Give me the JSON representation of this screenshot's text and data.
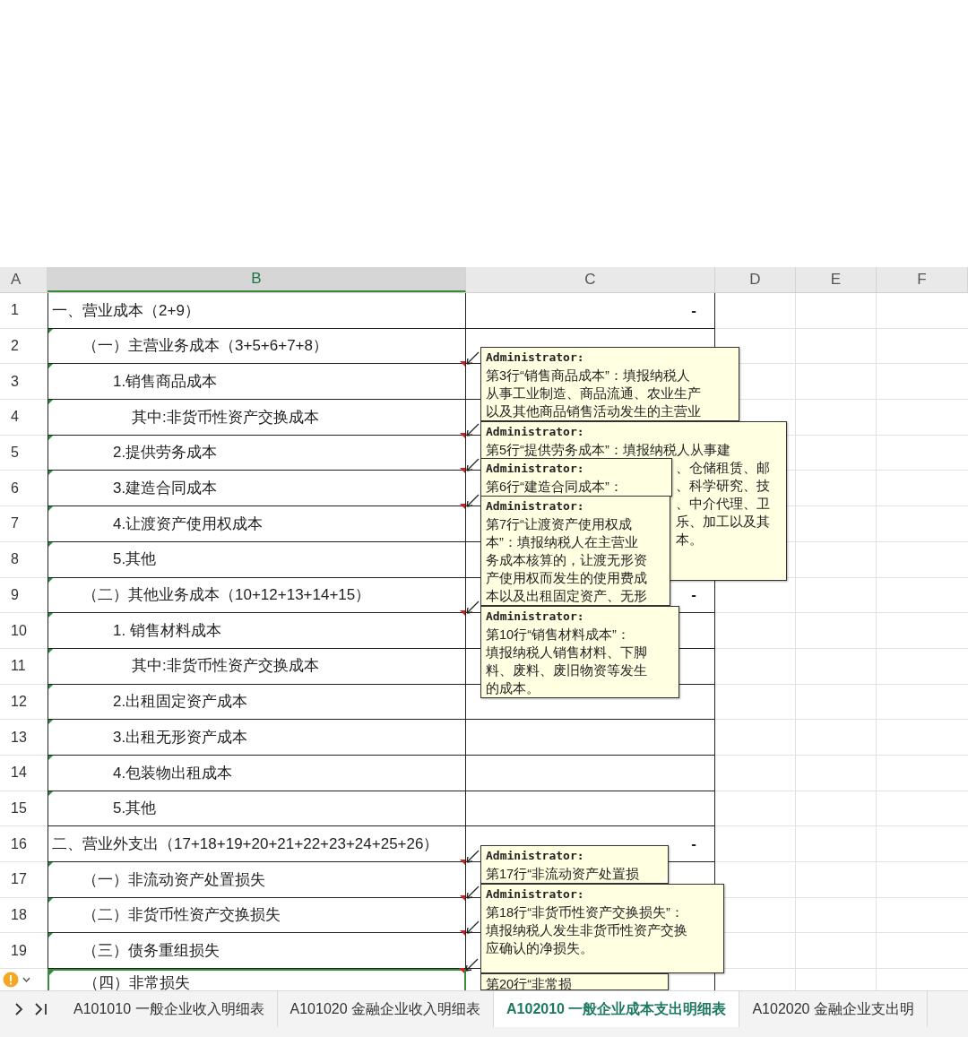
{
  "columns": [
    {
      "label": "A",
      "selected": false
    },
    {
      "label": "B",
      "selected": true
    },
    {
      "label": "C",
      "selected": false
    },
    {
      "label": "D",
      "selected": false
    },
    {
      "label": "E",
      "selected": false
    },
    {
      "label": "F",
      "selected": false
    }
  ],
  "rows": [
    {
      "number": "1",
      "kind": "section",
      "item": "一、营业成本（2+9）",
      "value": "-",
      "flagged": false,
      "has_comment": false
    },
    {
      "number": "2",
      "kind": "group",
      "item": "（一）主营业务成本（3+5+6+7+8）",
      "flagged": true,
      "has_comment": false
    },
    {
      "number": "3",
      "kind": "item",
      "item": "1.销售商品成本",
      "flagged": true,
      "has_comment": true,
      "comment": {
        "author": "Administrator:",
        "lines": [
          "第3行“销售商品成本”：填报纳税人",
          "从事工业制造、商品流通、农业生产",
          "以及其他商品销售活动发生的主营业"
        ]
      }
    },
    {
      "number": "4",
      "kind": "subitem",
      "item": "其中:非货币性资产交换成本",
      "flagged": true,
      "has_comment": false
    },
    {
      "number": "5",
      "kind": "item",
      "item": "2.提供劳务成本",
      "flagged": true,
      "has_comment": true,
      "comment": {
        "author": "Administrator:",
        "lines": [
          "第5行“提供劳务成本”：填报纳税人从事建"
        ],
        "covered_lines": [
          "、仓储租赁、邮",
          "、科学研究、技",
          "、中介代理、卫",
          "乐、加工以及其",
          "本。"
        ]
      }
    },
    {
      "number": "6",
      "kind": "item",
      "item": "3.建造合同成本",
      "flagged": true,
      "has_comment": true,
      "comment": {
        "author": "Administrator:",
        "lines": [
          "第6行“建造合同成本”："
        ]
      }
    },
    {
      "number": "7",
      "kind": "item",
      "item": "4.让渡资产使用权成本",
      "flagged": true,
      "has_comment": true,
      "comment": {
        "author": "Administrator:",
        "lines": [
          "第7行“让渡资产使用权成",
          "本”：填报纳税人在主营业",
          "务成本核算的，让渡无形资",
          "产使用权而发生的使用费成",
          "本以及出租固定资产、无形"
        ]
      }
    },
    {
      "number": "8",
      "kind": "item",
      "item": "5.其他",
      "flagged": true,
      "has_comment": false
    },
    {
      "number": "9",
      "kind": "group",
      "item": "（二）其他业务成本（10+12+13+14+15）",
      "value": "-",
      "flagged": true,
      "has_comment": false
    },
    {
      "number": "10",
      "kind": "item",
      "item": "1.  销售材料成本",
      "flagged": true,
      "has_comment": true,
      "comment": {
        "author": "Administrator:",
        "lines": [
          "第10行“销售材料成本”：",
          "填报纳税人销售材料、下脚",
          "料、废料、废旧物资等发生",
          "的成本。"
        ]
      }
    },
    {
      "number": "11",
      "kind": "subitem",
      "item": "其中:非货币性资产交换成本",
      "flagged": true,
      "has_comment": false
    },
    {
      "number": "12",
      "kind": "item",
      "item": "2.出租固定资产成本",
      "flagged": true,
      "has_comment": false
    },
    {
      "number": "13",
      "kind": "item",
      "item": "3.出租无形资产成本",
      "flagged": true,
      "has_comment": false
    },
    {
      "number": "14",
      "kind": "item",
      "item": "4.包装物出租成本",
      "flagged": true,
      "has_comment": false
    },
    {
      "number": "15",
      "kind": "item",
      "item": "5.其他",
      "flagged": true,
      "has_comment": false
    },
    {
      "number": "16",
      "kind": "section",
      "item": "二、营业外支出（17+18+19+20+21+22+23+24+25+26）",
      "value": "-",
      "flagged": false,
      "has_comment": false
    },
    {
      "number": "17",
      "kind": "group",
      "item": "（一）非流动资产处置损失",
      "flagged": true,
      "has_comment": true,
      "comment": {
        "author": "Administrator:",
        "lines": [
          "第17行“非流动资产处置损"
        ]
      }
    },
    {
      "number": "18",
      "kind": "group",
      "item": "（二）非货币性资产交换损失",
      "flagged": true,
      "has_comment": true,
      "comment": {
        "author": "Administrator:",
        "lines": [
          "第18行“非货币性资产交换损失”：",
          "填报纳税人发生非货币性资产交换",
          "应确认的净损失。"
        ]
      }
    },
    {
      "number": "19",
      "kind": "group",
      "item": "（三）债务重组损失",
      "flagged": true,
      "has_comment": true
    },
    {
      "kind": "group",
      "item": "（四）非常损失",
      "flagged": true,
      "has_comment": true,
      "comment": {
        "lines": [
          "第20行“非常损"
        ]
      }
    }
  ],
  "sheet_tabs": [
    {
      "label": "A101010 一般企业收入明细表",
      "selected": false
    },
    {
      "label": "A101020 金融企业收入明细表",
      "selected": false
    },
    {
      "label": "A102010 一般企业成本支出明细表",
      "selected": true
    },
    {
      "label": "A102020 金融企业支出明",
      "selected": false
    }
  ]
}
